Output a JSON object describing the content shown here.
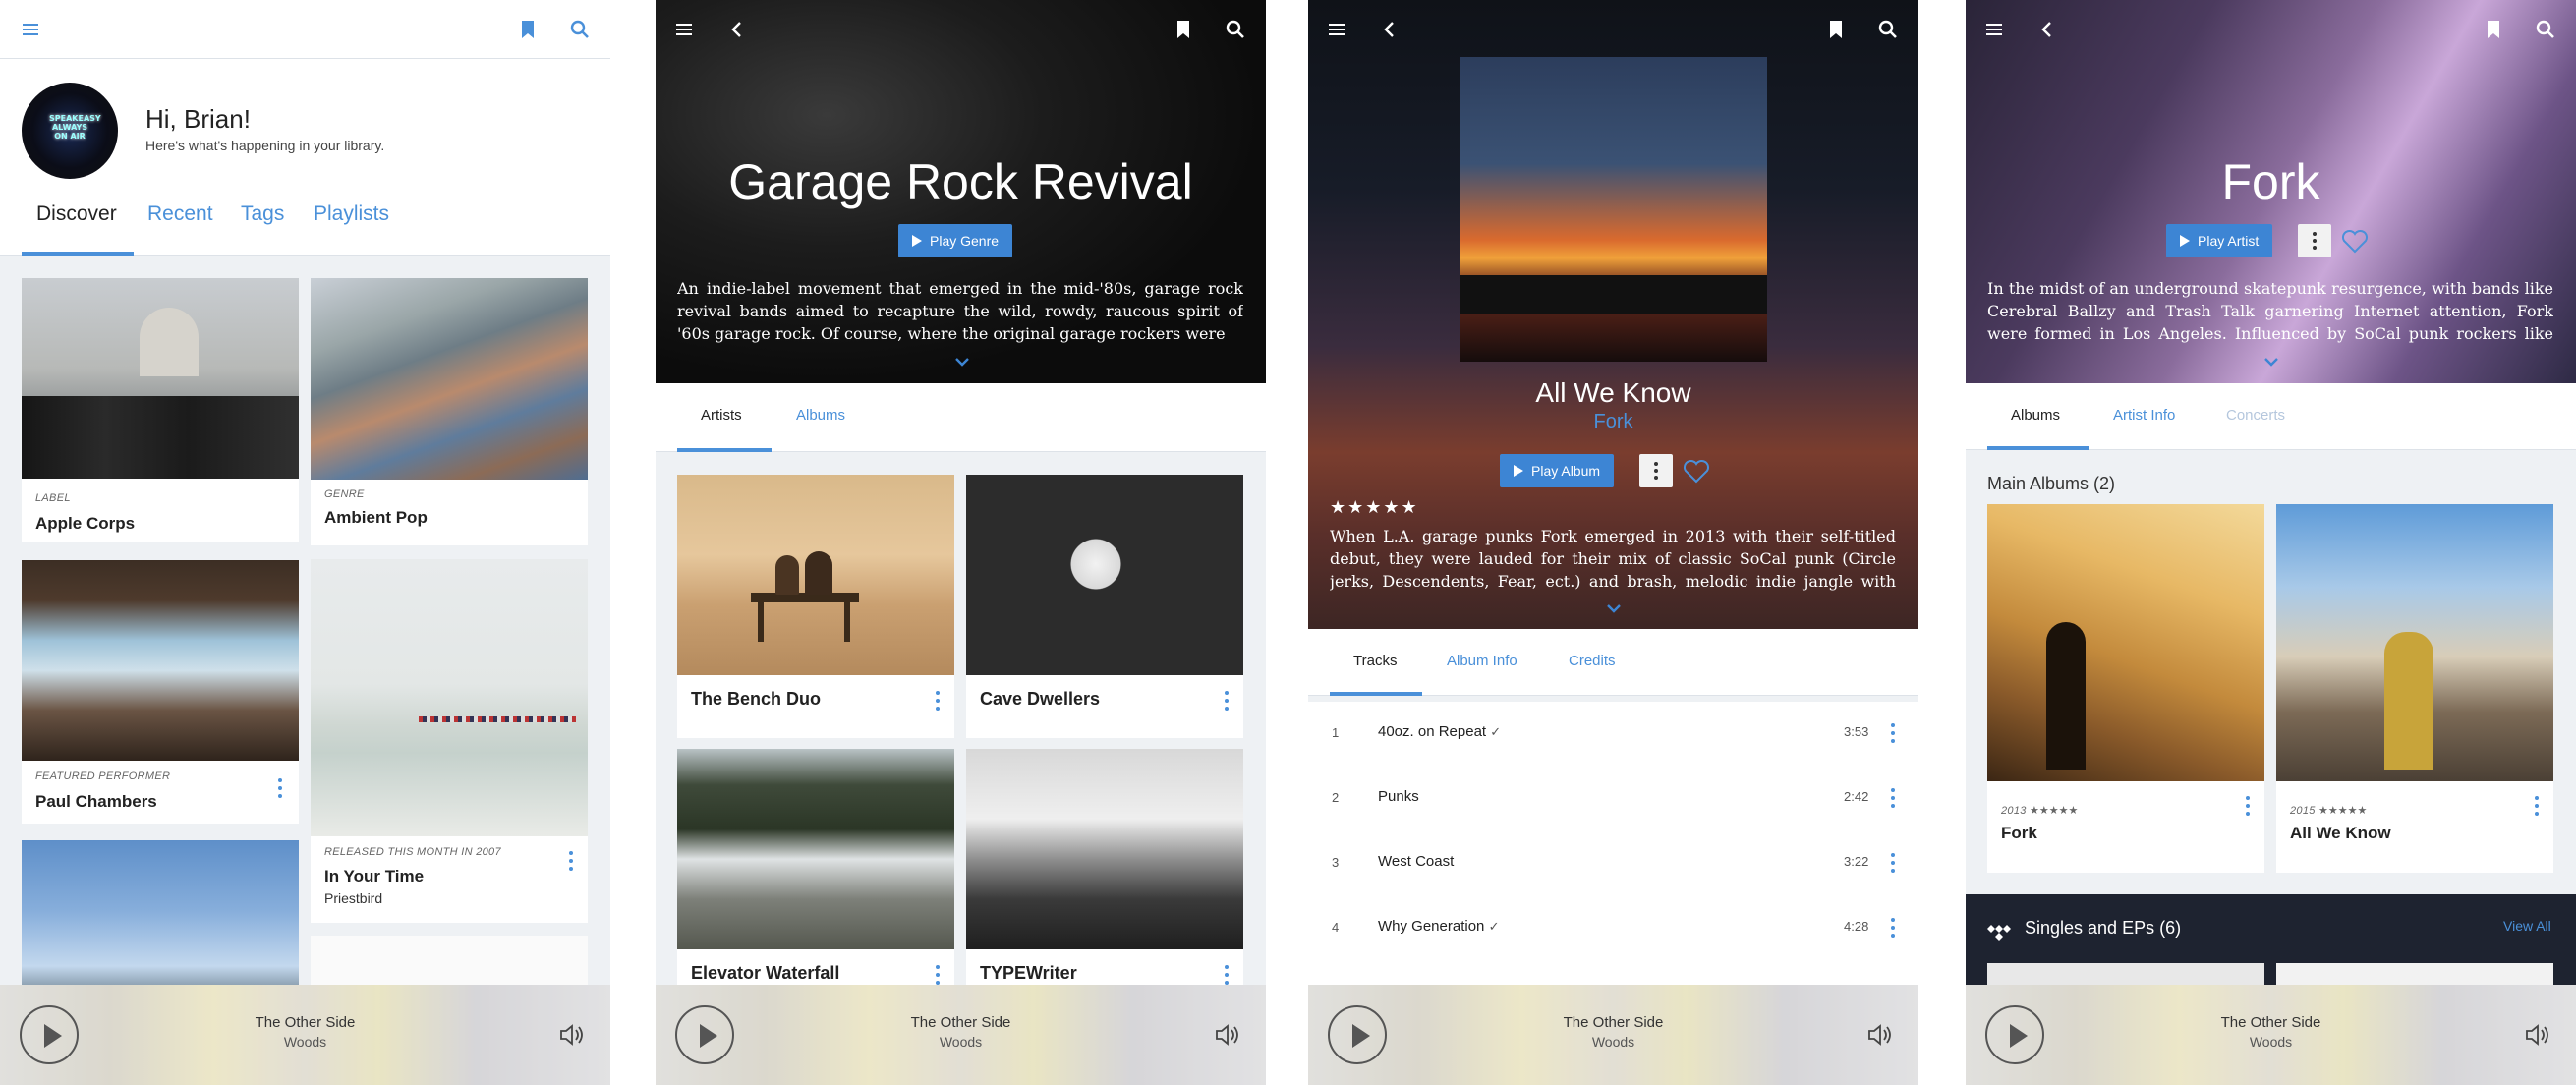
{
  "screen1": {
    "greeting": "Hi, Brian!",
    "subtitle": "Here's what's happening in your library.",
    "avatar_text": "SPEAKEASY ALWAYS ON AIR",
    "tabs": [
      "Discover",
      "Recent",
      "Tags",
      "Playlists"
    ],
    "cards": [
      {
        "meta": "LABEL",
        "title": "Apple Corps"
      },
      {
        "meta": "GENRE",
        "title": "Ambient Pop"
      },
      {
        "meta": "FEATURED PERFORMER",
        "title": "Paul Chambers"
      },
      {
        "meta": "RELEASED THIS MONTH IN 2007",
        "title": "In Your Time",
        "sub": "Priestbird"
      }
    ]
  },
  "screen2": {
    "title": "Garage Rock Revival",
    "play_label": "Play Genre",
    "description": "An indie-label movement that emerged in the mid-'80s, garage rock revival bands aimed to recapture the wild, rowdy, raucous spirit of '60s garage rock. Of course, where the original garage rockers were",
    "tabs": [
      "Artists",
      "Albums"
    ],
    "artists": [
      "The Bench Duo",
      "Cave Dwellers",
      "Elevator Waterfall",
      "TYPEWriter"
    ]
  },
  "screen3": {
    "album": "All We Know",
    "artist": "Fork",
    "play_label": "Play Album",
    "rating": "★★★★★",
    "description": "When L.A. garage punks Fork emerged in 2013 with their self-titled debut, they were lauded for their mix of classic SoCal punk (Circle jerks, Descendents, Fear, ect.) and brash, melodic indie jangle with occasional",
    "tabs": [
      "Tracks",
      "Album Info",
      "Credits"
    ],
    "tracks": [
      {
        "num": "1",
        "name": "40oz. on Repeat",
        "check": "✓",
        "dur": "3:53"
      },
      {
        "num": "2",
        "name": "Punks",
        "check": "",
        "dur": "2:42"
      },
      {
        "num": "3",
        "name": "West Coast",
        "check": "",
        "dur": "3:22"
      },
      {
        "num": "4",
        "name": "Why Generation",
        "check": "✓",
        "dur": "4:28"
      }
    ]
  },
  "screen4": {
    "artist": "Fork",
    "play_label": "Play Artist",
    "description": "In the midst of an underground skatepunk resurgence, with bands like Cerebral Ballzy and Trash Talk garnering Internet attention, Fork were formed in Los Angeles. Influenced by SoCal punk rockers like Offspring",
    "tabs": [
      "Albums",
      "Artist Info",
      "Concerts"
    ],
    "main_albums_heading": "Main Albums (2)",
    "albums": [
      {
        "year": "2013",
        "stars": "★★★★★",
        "title": "Fork"
      },
      {
        "year": "2015",
        "stars": "★★★★★",
        "title": "All We Know"
      }
    ],
    "singles_heading": "Singles and EPs (6)",
    "view_all": "View All"
  },
  "player": {
    "title": "The Other Side",
    "artist": "Woods"
  },
  "colors": {
    "accent": "#4a90d9",
    "button": "#3d85d4",
    "dark": "#1e2330"
  },
  "icons": [
    "menu-icon",
    "bookmark-icon",
    "search-icon",
    "back-icon",
    "chevron-down-icon",
    "play-icon",
    "volume-icon",
    "more-icon",
    "heart-icon",
    "tidal-icon"
  ]
}
